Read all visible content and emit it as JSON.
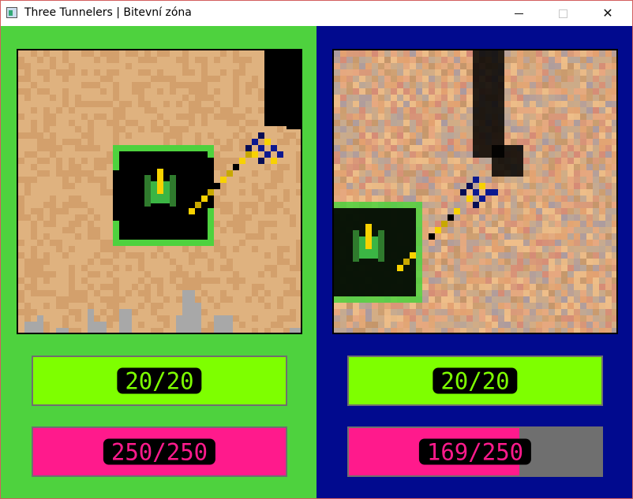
{
  "window": {
    "title": "Three Tunnelers | Bitevní zóna",
    "controls": {
      "minimize_icon": "minimize-icon",
      "maximize_icon": "maximize-icon",
      "close_icon": "close-icon",
      "close_glyph": "✕"
    }
  },
  "colors": {
    "left_panel": "#4ed23e",
    "right_panel": "#010a8e",
    "energy": "#7eff00",
    "health": "#ff1a8c",
    "dirt": "#dfb27f",
    "dirt_dark": "#d3a06c",
    "tunnel": "#000000",
    "rock": "#a8a8a8",
    "base_wall_green": "#4ed23e",
    "player_tank_green": "#3bb544",
    "enemy_tank_blue": "#0b1890",
    "tank_yellow": "#f8d200",
    "bar_empty": "#6f6f6f"
  },
  "players": [
    {
      "id": "green",
      "energy": {
        "current": 20,
        "max": 20,
        "label": "20/20"
      },
      "health": {
        "current": 250,
        "max": 250,
        "label": "250/250"
      }
    },
    {
      "id": "blue",
      "energy": {
        "current": 20,
        "max": 20,
        "label": "20/20"
      },
      "health": {
        "current": 169,
        "max": 250,
        "label": "169/250"
      }
    }
  ]
}
